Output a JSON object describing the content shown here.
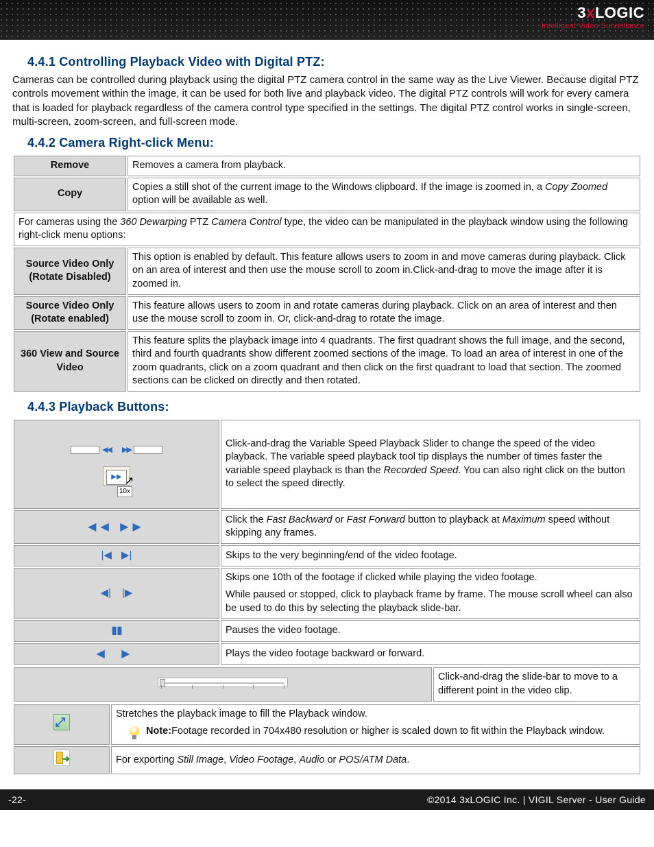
{
  "brand": {
    "name_pre": "3",
    "name_x": "x",
    "name_post": "LOGIC",
    "tagline": "Intelligent Video Surveillance"
  },
  "section_441": {
    "heading": "4.4.1 Controlling Playback Video with Digital PTZ:",
    "body": "Cameras can be controlled during playback using the digital PTZ camera control in the same way as the Live Viewer. Because digital PTZ controls movement within the image, it can be used for both live and playback video. The digital PTZ controls will work for every camera that is loaded for playback regardless of the camera control type specified in the settings. The digital PTZ control works in single-screen, multi-screen, zoom-screen, and full-screen mode."
  },
  "section_442": {
    "heading": "4.4.2 Camera Right-click Menu:",
    "rows": [
      {
        "label": "Remove",
        "desc": "Removes a camera from playback."
      },
      {
        "label": "Copy",
        "desc_pre": "Copies a still shot of the current image to the Windows clipboard.  If the image is zoomed in, a ",
        "desc_em": "Copy Zoomed",
        "desc_post": " option will be available as well."
      }
    ],
    "note_pre": "For cameras using the ",
    "note_em1": "360 Dewarping",
    "note_mid": " PTZ ",
    "note_em2": "Camera Control",
    "note_post": " type, the video can be manipulated in the playback window using the following right-click menu options:",
    "dewarp_rows": [
      {
        "label": "Source Video Only (Rotate Disabled)",
        "desc": "This option is enabled by default. This feature allows users to zoom in and move cameras during playback. Click on an area of interest and then use the mouse scroll to zoom in.Click-and-drag to move the image after it is zoomed in."
      },
      {
        "label": "Source Video Only (Rotate enabled)",
        "desc": "This feature allows users to zoom in and rotate cameras during playback. Click on an area of interest and then use the mouse scroll to zoom in. Or, click-and-drag to rotate the image."
      },
      {
        "label": "360 View and Source Video",
        "desc": "This feature splits the playback image into 4 quadrants. The first quadrant shows the full image, and the second, third and fourth quadrants show different zoomed sections of the image. To load an area of interest in one of the zoom quadrants, click on a zoom quadrant and then click on the first quadrant to load that section. The zoomed sections can be clicked on directly and then rotated."
      }
    ]
  },
  "section_443": {
    "heading": "4.4.3 Playback Buttons:",
    "speed_tooltip": "10x",
    "rows": {
      "variable_speed": {
        "pre": "Click-and-drag the Variable Speed Playback Slider to change the speed of the video playback. The variable speed playback tool tip displays the number of times faster the variable speed playback is than the ",
        "em": "Recorded Speed",
        "post": ".  You can also right click on the button to select the speed directly."
      },
      "fast": {
        "pre": "Click the ",
        "em1": "Fast Backward",
        "mid1": " or ",
        "em2": "Fast Forward",
        "mid2": " button to playback at ",
        "em3": "Maximum",
        "post": " speed without skipping any frames."
      },
      "skip_ends": "Skips to the very beginning/end of the video footage.",
      "skip_tenth_line1": "Skips one 10th of the footage if clicked while playing the video footage.",
      "skip_tenth_line2": "While paused or stopped, click to playback frame by frame.  The mouse scroll wheel can also be used to do this by selecting the playback slide-bar.",
      "pause": "Pauses the video footage.",
      "play": "Plays the video footage backward or forward.",
      "slidebar": "Click-and-drag the slide-bar to move to a different point in the video clip.",
      "stretch_line": "Stretches the playback image to fill the Playback window.",
      "stretch_note_label": "Note:",
      "stretch_note": "Footage recorded in 704x480 resolution or higher is scaled down to fit within the Playback window.",
      "export": {
        "pre": "For exporting ",
        "em1": "Still Image",
        "s1": ", ",
        "em2": "Video Footage",
        "s2": ", ",
        "em3": "Audio",
        "s3": " or ",
        "em4": "POS/ATM Data",
        "post": "."
      }
    }
  },
  "footer": {
    "left": "-22-",
    "right": "©2014 3xLOGIC Inc.  |  VIGIL Server - User Guide"
  }
}
